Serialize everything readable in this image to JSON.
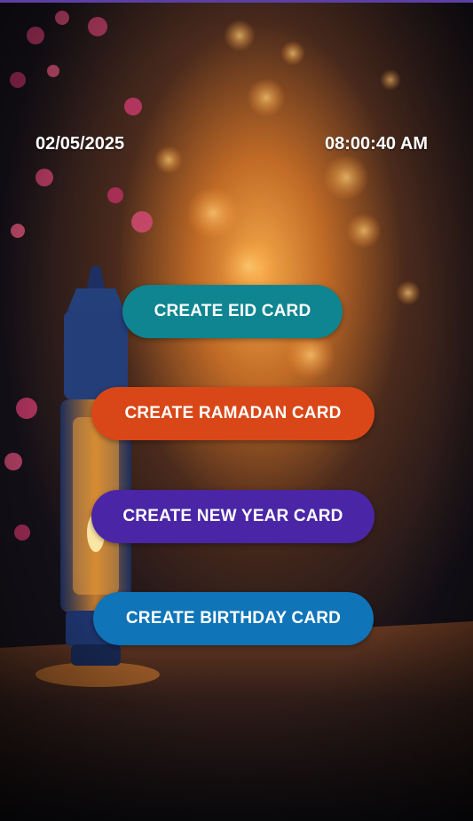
{
  "status": {
    "date": "02/05/2025",
    "time": "08:00:40 AM"
  },
  "actions": [
    {
      "label": "CREATE EID CARD",
      "color": "#0e8590"
    },
    {
      "label": "CREATE RAMADAN CARD",
      "color": "#d94718"
    },
    {
      "label": "CREATE NEW YEAR CARD",
      "color": "#4a26a6"
    },
    {
      "label": "CREATE BIRTHDAY CARD",
      "color": "#0f74b8"
    }
  ],
  "background": {
    "subject": "festive lantern with bokeh lights and pink blossoms"
  }
}
